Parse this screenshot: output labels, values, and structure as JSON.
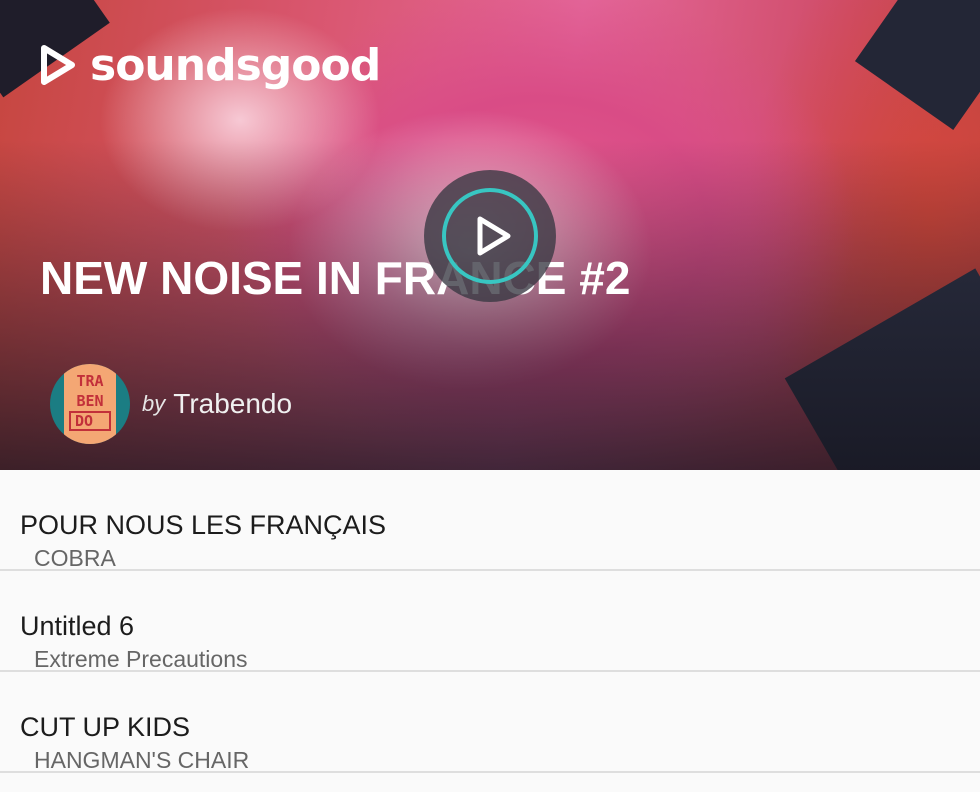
{
  "brand": {
    "name": "soundsgood",
    "logo_icon": "play-triangle-icon"
  },
  "playlist": {
    "title": "NEW NOISE IN FRANCE #2",
    "by_label": "by",
    "author": "Trabendo",
    "avatar_letters": [
      "TRA",
      "BEN",
      "DO"
    ],
    "play_icon": "play-icon"
  },
  "colors": {
    "accent": "#38c6c2",
    "avatar_bg": "#1b7d83",
    "avatar_tile": "#f4a774",
    "avatar_text": "#c2303a"
  },
  "tracks": [
    {
      "title": "POUR NOUS LES FRANÇAIS",
      "artist": "COBRA"
    },
    {
      "title": "Untitled 6",
      "artist": "Extreme Precautions"
    },
    {
      "title": "CUT UP KIDS",
      "artist": "HANGMAN'S CHAIR"
    }
  ]
}
